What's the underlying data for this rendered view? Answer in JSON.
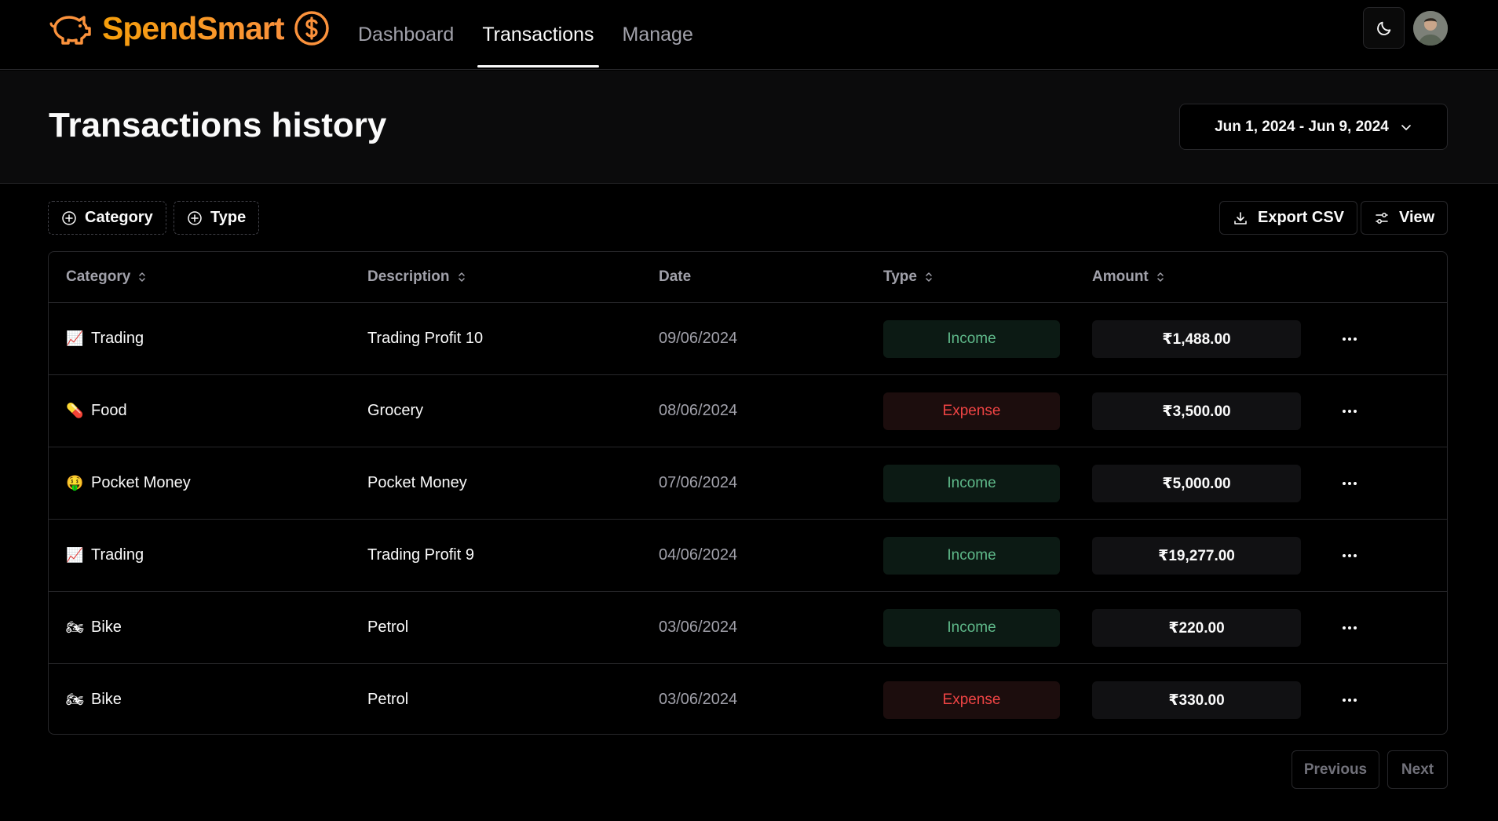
{
  "brand": {
    "name": "SpendSmart"
  },
  "nav": {
    "items": [
      {
        "label": "Dashboard",
        "active": false
      },
      {
        "label": "Transactions",
        "active": true
      },
      {
        "label": "Manage",
        "active": false
      }
    ]
  },
  "header": {
    "title": "Transactions history",
    "date_range": "Jun 1, 2024 - Jun 9, 2024"
  },
  "toolbar": {
    "filter_category": "Category",
    "filter_type": "Type",
    "export": "Export CSV",
    "view": "View"
  },
  "table": {
    "columns": [
      "Category",
      "Description",
      "Date",
      "Type",
      "Amount"
    ],
    "rows": [
      {
        "icon": "chart-increasing-emoji",
        "emoji": "📈",
        "category": "Trading",
        "description": "Trading Profit 10",
        "date": "09/06/2024",
        "type": "Income",
        "amount": "₹1,488.00"
      },
      {
        "icon": "pill-emoji",
        "emoji": "💊",
        "category": "Food",
        "description": "Grocery",
        "date": "08/06/2024",
        "type": "Expense",
        "amount": "₹3,500.00"
      },
      {
        "icon": "money-mouth-face-emoji",
        "emoji": "🤑",
        "category": "Pocket Money",
        "description": "Pocket Money",
        "date": "07/06/2024",
        "type": "Income",
        "amount": "₹5,000.00"
      },
      {
        "icon": "chart-increasing-emoji",
        "emoji": "📈",
        "category": "Trading",
        "description": "Trading Profit 9",
        "date": "04/06/2024",
        "type": "Income",
        "amount": "₹19,277.00"
      },
      {
        "icon": "motorcycle-emoji",
        "emoji": "🏍",
        "category": "Bike",
        "description": "Petrol",
        "date": "03/06/2024",
        "type": "Income",
        "amount": "₹220.00"
      },
      {
        "icon": "motorcycle-emoji",
        "emoji": "🏍",
        "category": "Bike",
        "description": "Petrol",
        "date": "03/06/2024",
        "type": "Expense",
        "amount": "₹330.00"
      }
    ]
  },
  "pagination": {
    "previous": "Previous",
    "next": "Next"
  },
  "colors": {
    "brand": "#fb923c",
    "income": "#5fb98a",
    "expense": "#ef4444",
    "background": "#000000"
  }
}
